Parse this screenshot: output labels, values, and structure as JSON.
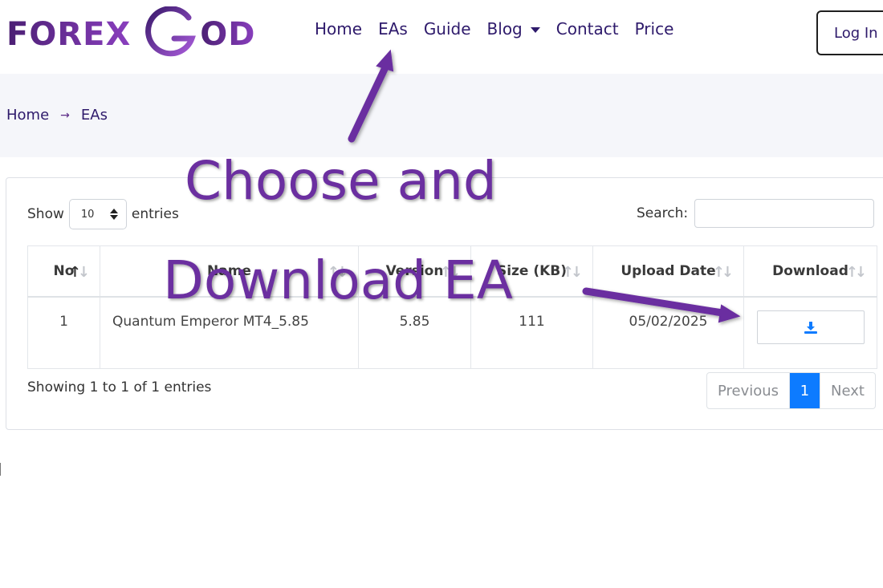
{
  "brand": {
    "name_left": "FOREX",
    "name_right": "OD"
  },
  "nav": {
    "items": [
      "Home",
      "EAs",
      "Guide",
      "Blog",
      "Contact",
      "Price"
    ],
    "login": "Log In"
  },
  "breadcrumb": {
    "home": "Home",
    "separator": "→",
    "current": "EAs"
  },
  "table_controls": {
    "show_label": "Show",
    "page_length": "10",
    "entries_label": "entries",
    "search_label": "Search:",
    "search_value": ""
  },
  "table": {
    "columns": [
      "No",
      "Name",
      "Version",
      "Size (KB)",
      "Upload Date",
      "Download"
    ],
    "rows": [
      {
        "no": "1",
        "name": "Quantum Emperor MT4_5.85",
        "version": "5.85",
        "size": "111",
        "upload_date": "05/02/2025"
      }
    ]
  },
  "footer": {
    "info": "Showing 1 to 1 of 1 entries",
    "prev": "Previous",
    "page": "1",
    "next": "Next"
  },
  "annotation": {
    "line1": "Choose and",
    "line2": "Download EA"
  },
  "colors": {
    "brand_purple": "#6b2fa0",
    "primary_blue": "#0d7bff",
    "nav_text": "#2e1a6b"
  }
}
